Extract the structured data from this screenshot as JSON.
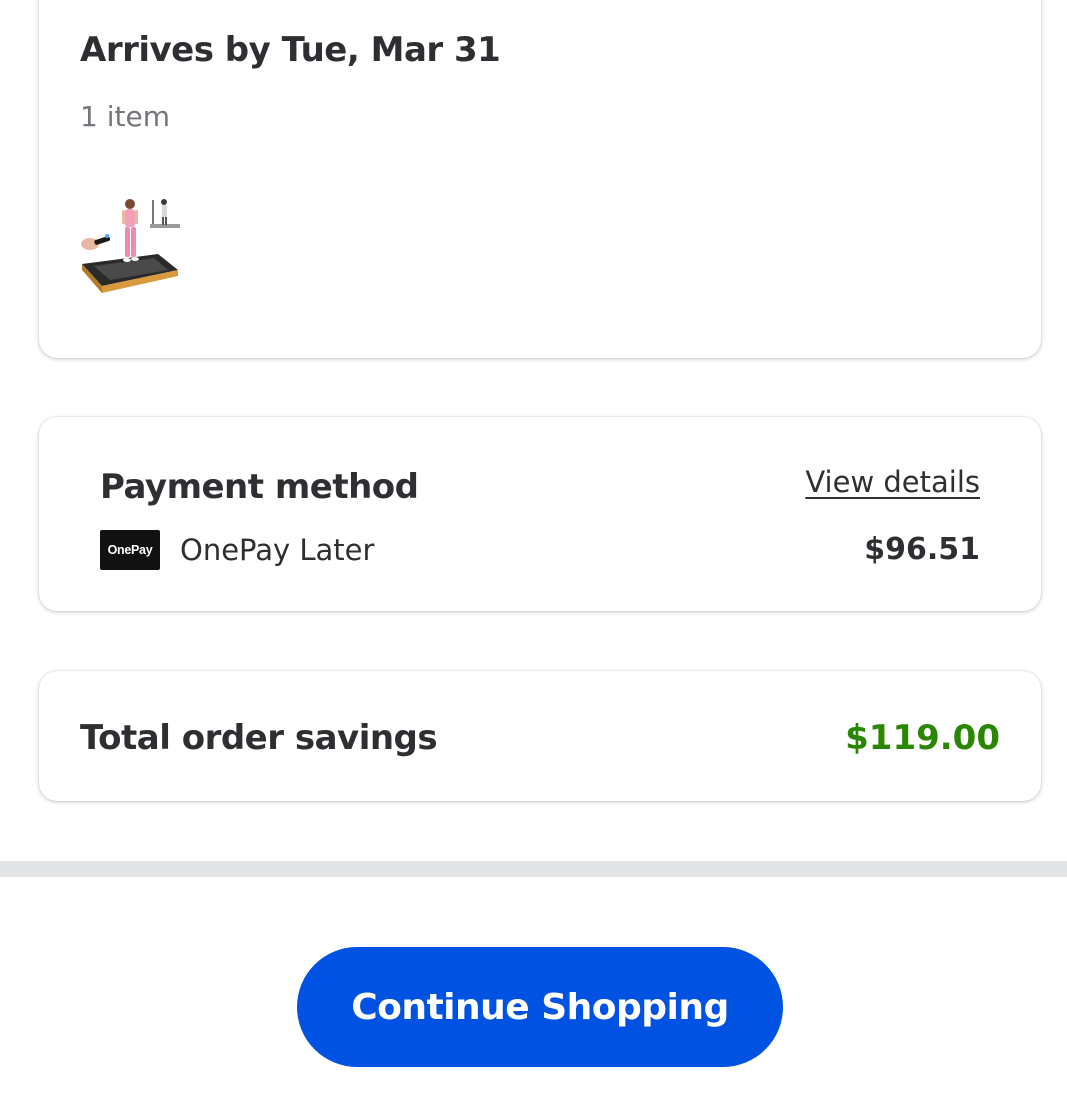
{
  "delivery": {
    "title": "Arrives by Tue, Mar 31",
    "item_count": "1 item",
    "thumbnail_icon": "treadmill-product-image"
  },
  "payment": {
    "title": "Payment method",
    "view_details_label": "View details",
    "logo_text": "OnePay",
    "method_label": "OnePay Later",
    "amount": "$96.51"
  },
  "savings": {
    "label": "Total order savings",
    "amount": "$119.00",
    "amount_color": "#2a8703"
  },
  "footer": {
    "continue_label": "Continue Shopping",
    "button_color": "#0053e2"
  }
}
